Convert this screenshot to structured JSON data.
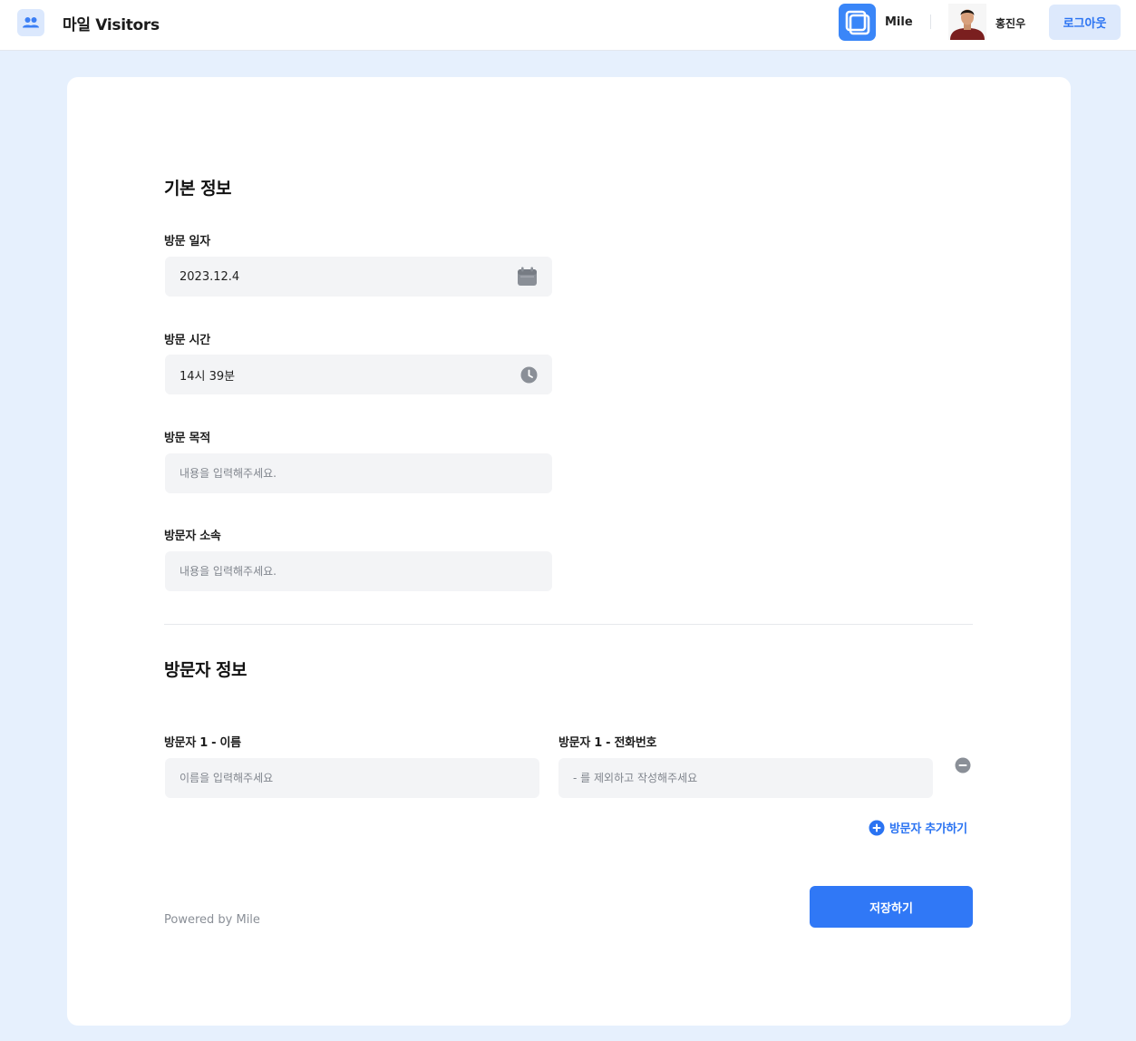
{
  "header": {
    "title": "마일 Visitors",
    "app_icon": "people-icon",
    "org_name": "Mile",
    "user_name": "홍진우",
    "logout_label": "로그아웃"
  },
  "basic_info": {
    "title": "기본 정보",
    "visit_date": {
      "label": "방문 일자",
      "value": "2023.12.4",
      "icon": "calendar-icon"
    },
    "visit_time": {
      "label": "방문 시간",
      "value": "14시 39분",
      "icon": "clock-icon"
    },
    "visit_purpose": {
      "label": "방문 목적",
      "placeholder": "내용을 입력해주세요."
    },
    "visitor_affiliation": {
      "label": "방문자 소속",
      "placeholder": "내용을 입력해주세요."
    }
  },
  "visitor_info": {
    "title": "방문자 정보",
    "visitors": [
      {
        "name_label": "방문자 1 - 이름",
        "name_placeholder": "이름을 입력해주세요",
        "phone_label": "방문자 1 - 전화번호",
        "phone_placeholder": "- 를 제외하고 작성해주세요"
      }
    ],
    "add_label": "방문자 추가하기"
  },
  "footer": {
    "powered_by": "Powered by Mile",
    "save_label": "저장하기"
  },
  "colors": {
    "page_bg": "#e6f0fd",
    "accent": "#3078f6",
    "field_bg": "#f3f4f6"
  }
}
